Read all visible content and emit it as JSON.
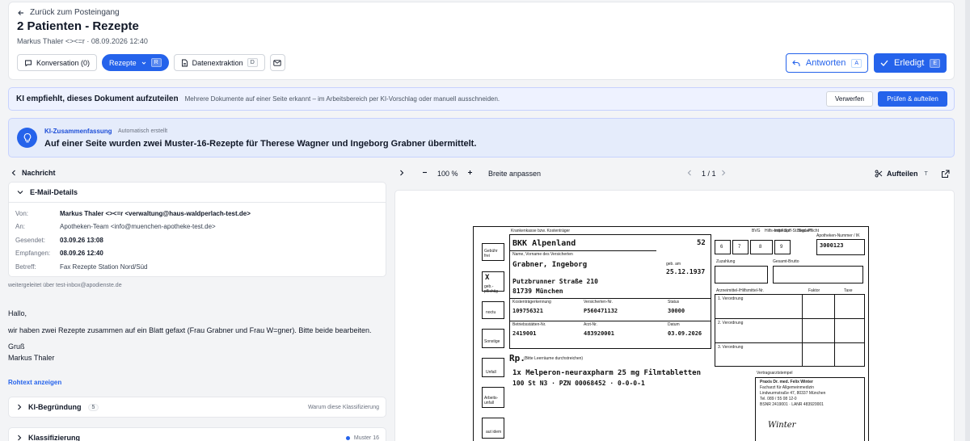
{
  "header": {
    "back_label": "Zurück zum Posteingang",
    "title": "2 Patienten - Rezepte",
    "meta": "Markus Thaler <><=r · 08.09.2026 12:40",
    "tabs": [
      {
        "label": "Konversation (0)",
        "icon": "chat-icon"
      },
      {
        "label": "Rezepte",
        "icon": "chevron-down-icon",
        "kbd": "R",
        "active": true
      },
      {
        "label": "Datenextraktion",
        "icon": "document-icon",
        "kbd": "D"
      }
    ],
    "reply_label": "Antworten",
    "reply_kbd": "A",
    "done_label": "Erledigt",
    "done_kbd": "E"
  },
  "split_banner": {
    "title": "KI empfiehlt, dieses Dokument aufzuteilen",
    "description": "Mehrere Dokumente auf einer Seite erkannt – im Arbeitsbereich per KI-Vorschlag oder manuell ausschneiden.",
    "discard_label": "Verwerfen",
    "check_label": "Prüfen & aufteilen"
  },
  "summary": {
    "label": "KI-Zusammenfassung",
    "auto": "Automatisch erstellt",
    "text": "Auf einer Seite wurden zwei Muster-16-Rezepte für Therese Wagner und Ingeborg Grabner übermittelt."
  },
  "message": {
    "nav_label": "Nachricht",
    "details_title": "E-Mail-Details",
    "rows": [
      {
        "label": "Von:",
        "value": "Markus Thaler <><=r <verwaltung@haus-waldperlach-test.de>"
      },
      {
        "label": "An:",
        "value": "Apotheken-Team <info@muenchen-apotheke-test.de>"
      },
      {
        "label": "Gesendet:",
        "value": "03.09.26 13:08"
      },
      {
        "label": "Empfangen:",
        "value": "08.09.26 12:40"
      },
      {
        "label": "Betreff:",
        "value": "Fax Rezepte Station Nord/Süd"
      }
    ],
    "forwarded": "weitergeleitet über test-inbox@apodienste.de",
    "greeting": "Hallo,",
    "body": "wir haben zwei Rezepte zusammen auf ein Blatt gefaxt (Frau Grabner und Frau W=gner). Bitte beide bearbeiten.",
    "closing": "Gruß",
    "signature": "Markus Thaler",
    "raw_link": "Rohtext anzeigen"
  },
  "accordions": {
    "reason": {
      "title": "KI-Begründung",
      "count": "5",
      "hint": "Warum diese Klassifizierung"
    },
    "classification": {
      "title": "Klassifizierung",
      "value": "Muster 16"
    }
  },
  "viewer": {
    "zoom": "100 %",
    "fit_label": "Breite anpassen",
    "page": "1 / 1",
    "split_label": "Aufteilen",
    "split_kbd": "T"
  },
  "fax": {
    "insurer_label": "Krankenkasse bzw. Kostenträger",
    "insurer": "BKK Alpenland",
    "insurer_code": "52",
    "name_label": "Name, Vorname des Versicherten",
    "patient_name": "Grabner, Ingeborg",
    "birth_label": "geb. am",
    "birth_date": "25.12.1937",
    "street": "Putzbrunner Straße 210",
    "city": "81739 München",
    "kk_id_label": "Kostenträgerkennung",
    "kk_id": "109756321",
    "insured_no_label": "Versicherten-Nr.",
    "insured_no": "P560471132",
    "status_label": "Status",
    "status": "30000",
    "bsnr_label": "Betriebsstätten-Nr.",
    "bsnr": "2419001",
    "lanr_label": "Arzt-Nr.",
    "lanr": "483920001",
    "date_label": "Datum",
    "date": "03.09.2026",
    "rp": "Rp.",
    "rp_hint": "(Bitte Leerräume durchstreichen)",
    "drug_line1": "1x Melperon-neuraxpharm 25 mg Filmtabletten",
    "drug_line2": "100 St N3  ·  PZN 00068452  ·  0-0-0-1",
    "pharmacy_no_label": "Apotheken-Nummer / IK",
    "pharmacy_no": "3000123",
    "zuzahlung_label": "Zuzahlung",
    "gesamt_label": "Gesamt-Brutto",
    "az_label": "Arzneimittel-/Hilfsmittel-Nr.",
    "faktor_label": "Faktor",
    "taxe_label": "Taxe",
    "v1": "1. Verordnung",
    "v2": "2. Verordnung",
    "v3": "3. Verordnung",
    "stamp_label": "Vertragsarztstempel",
    "doctor": "Praxis Dr. med. Felix Winter",
    "doctor_spec": "Facharzt für Allgemeinmedizin",
    "doctor_addr": "Lindwurmstraße 47, 80337 München",
    "doctor_tel": "Tel. 089 / 55 08 12-0",
    "doctor_ids": "BSNR 2419001 · LANR 483920001",
    "signature": "Winter",
    "side_boxes": [
      "Gebühr frei",
      "X",
      "geb.-pflichtig",
      "noctu",
      "Sonstige",
      "Unfall",
      "Arbeits-unfall",
      "aut idem"
    ],
    "bvg_labels": [
      "BVG",
      "Hilfs-mittel",
      "Impf-stoff",
      "Spr.-St. Bedarf",
      "Begr.-Pflicht"
    ],
    "bvg_digits": [
      "6",
      "7",
      "8",
      "9"
    ]
  }
}
